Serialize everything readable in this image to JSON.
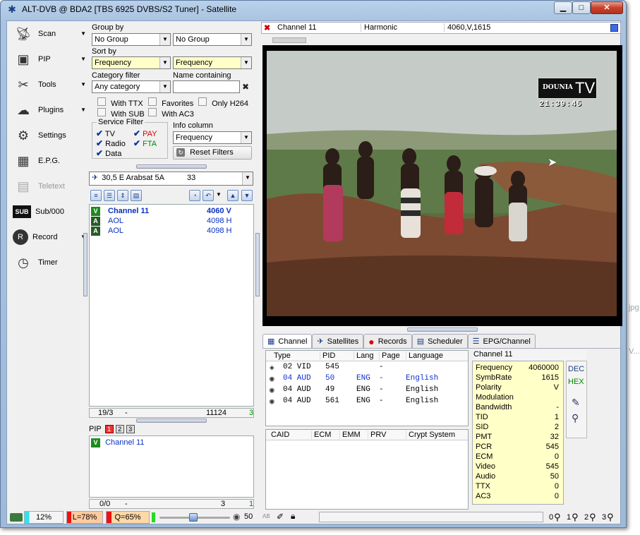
{
  "window": {
    "title": "ALT-DVB @ BDA2 [TBS 6925 DVBS/S2 Tuner] - Satellite",
    "minimize": "▁",
    "maximize": "□",
    "close": "✕"
  },
  "nav": [
    {
      "label": "Scan",
      "icon": "satellite-dish-icon",
      "arrow": "▼"
    },
    {
      "label": "PIP",
      "icon": "pip-icon",
      "arrow": "▼"
    },
    {
      "label": "Tools",
      "icon": "tools-icon",
      "arrow": "▼"
    },
    {
      "label": "Plugins",
      "icon": "plugins-icon",
      "arrow": "▼"
    },
    {
      "label": "Settings",
      "icon": "settings-gear-icon",
      "arrow": ""
    },
    {
      "label": "E.P.G.",
      "icon": "epg-icon",
      "arrow": ""
    },
    {
      "label": "Teletext",
      "icon": "teletext-icon",
      "arrow": ""
    },
    {
      "label": "Sub/000",
      "icon": "subtitle-icon",
      "arrow": ""
    },
    {
      "label": "Record",
      "icon": "record-icon",
      "arrow": "▼"
    },
    {
      "label": "Timer",
      "icon": "timer-icon",
      "arrow": ""
    }
  ],
  "filters": {
    "group_by": "Group by",
    "group1": "No Group",
    "group2": "No Group",
    "sort_by": "Sort by",
    "sort1": "Frequency",
    "sort2": "Frequency",
    "category_filter": "Category filter",
    "category": "Any category",
    "name_containing": "Name containing",
    "name_value": "",
    "with_ttx": "With TTX",
    "favorites": "Favorites",
    "only_h264": "Only H264",
    "with_sub": "With SUB",
    "with_ac3": "With AC3",
    "service_filter": "Service Filter",
    "tv": "TV",
    "pay": "PAY",
    "radio": "Radio",
    "fta": "FTA",
    "data": "Data",
    "info_column": "Info column",
    "info_value": "Frequency",
    "reset": "Reset Filters"
  },
  "satellite": {
    "name": "30,5 E Arabsat 5A",
    "count": "33"
  },
  "channels": [
    {
      "type": "V",
      "name": "Channel 11",
      "freq": "4060 V",
      "bold": true
    },
    {
      "type": "A",
      "name": "AOL",
      "freq": "4098 H",
      "bold": false
    },
    {
      "type": "A",
      "name": "AOL",
      "freq": "4098 H",
      "bold": false
    }
  ],
  "channel_status": {
    "pos": "19/3",
    "dash": "-",
    "count": "11124",
    "extra": "3"
  },
  "pip": {
    "label": "PIP",
    "b1": "1",
    "b2": "2",
    "b3": "3",
    "channel": "Channel 11"
  },
  "pip_status": {
    "pos": "0/0",
    "dash": "-",
    "count": "3",
    "extra": "1"
  },
  "status_bar": {
    "signal": "12%",
    "level": "L=78%",
    "quality": "Q=65%",
    "volume": "50",
    "ab": "AB"
  },
  "video_header": {
    "channel": "Channel 11",
    "provider": "Harmonic",
    "params": "4060,V,1615"
  },
  "overlay": {
    "logo_a": "DOUNIA",
    "logo_b": "TV",
    "clock": "21:39:45"
  },
  "tabs": [
    {
      "label": "Channel",
      "icon": "channel-grid-icon"
    },
    {
      "label": "Satellites",
      "icon": "satellite-icon"
    },
    {
      "label": "Records",
      "icon": "record-red-icon"
    },
    {
      "label": "Scheduler",
      "icon": "scheduler-icon"
    },
    {
      "label": "EPG/Channel",
      "icon": "epg-channel-icon"
    }
  ],
  "pid_table": {
    "headers": [
      "Type",
      "PID",
      "Lang",
      "Page",
      "Language"
    ],
    "rows": [
      {
        "type": "02 VID",
        "pid": "545",
        "lang": "",
        "page": "-",
        "language": ""
      },
      {
        "type": "04 AUD",
        "pid": "50",
        "lang": "ENG",
        "page": "-",
        "language": "English",
        "highlight": true
      },
      {
        "type": "04 AUD",
        "pid": "49",
        "lang": "ENG",
        "page": "-",
        "language": "English"
      },
      {
        "type": "04 AUD",
        "pid": "561",
        "lang": "ENG",
        "page": "-",
        "language": "English"
      }
    ]
  },
  "ca_table": {
    "headers": [
      "CAID",
      "ECM",
      "EMM",
      "PRV",
      "Crypt System"
    ]
  },
  "info": {
    "title": "Channel 11",
    "fields": [
      {
        "k": "Frequency",
        "v": "4060000"
      },
      {
        "k": "SymbRate",
        "v": "1615"
      },
      {
        "k": "Polarity",
        "v": "V"
      },
      {
        "k": "Modulation",
        "v": ""
      },
      {
        "k": "Bandwidth",
        "v": "-"
      },
      {
        "k": "TID",
        "v": "1"
      },
      {
        "k": "SID",
        "v": "2"
      },
      {
        "k": "PMT",
        "v": "32"
      },
      {
        "k": "PCR",
        "v": "545"
      },
      {
        "k": "ECM",
        "v": "0"
      },
      {
        "k": "Video",
        "v": "545"
      },
      {
        "k": "Audio",
        "v": "50"
      },
      {
        "k": "TTX",
        "v": "0"
      },
      {
        "k": "AC3",
        "v": "0"
      }
    ],
    "dec": "DEC",
    "hex": "HEX"
  },
  "zoom": [
    "0",
    "1",
    "2",
    "3"
  ],
  "background_fragments": {
    "jp": "jpg",
    "v": "V..."
  }
}
